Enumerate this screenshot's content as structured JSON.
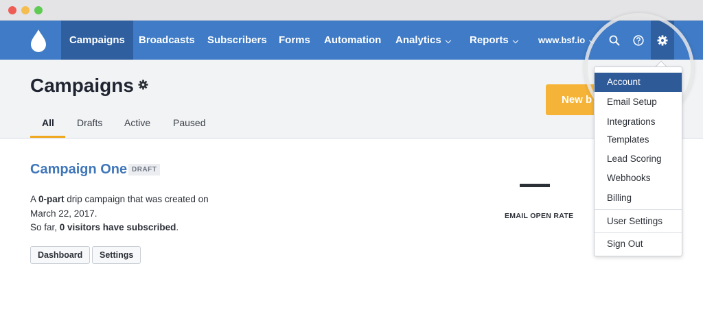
{
  "nav": {
    "items": [
      {
        "label": "Campaigns",
        "active": true,
        "has_dropdown": false
      },
      {
        "label": "Broadcasts",
        "active": false,
        "has_dropdown": false
      },
      {
        "label": "Subscribers",
        "active": false,
        "has_dropdown": false
      },
      {
        "label": "Forms",
        "active": false,
        "has_dropdown": false
      },
      {
        "label": "Automation",
        "active": false,
        "has_dropdown": false
      },
      {
        "label": "Analytics",
        "active": false,
        "has_dropdown": true
      },
      {
        "label": "Reports",
        "active": false,
        "has_dropdown": true
      }
    ],
    "site": "www.bsf.io",
    "icons": [
      "drop-logo",
      "search-icon",
      "help-icon",
      "gear-icon"
    ]
  },
  "header": {
    "title": "Campaigns",
    "tabs": [
      {
        "label": "All",
        "active": true
      },
      {
        "label": "Drafts",
        "active": false
      },
      {
        "label": "Active",
        "active": false
      },
      {
        "label": "Paused",
        "active": false
      }
    ],
    "new_button": "New b"
  },
  "campaign": {
    "title": "Campaign One",
    "badge": "DRAFT",
    "desc_a": "A ",
    "desc_b": "0-part",
    "desc_c": " drip campaign that was created on March 22, 2017.",
    "desc_d": "So far, ",
    "desc_e": "0 visitors have subscribed",
    "desc_f": ".",
    "dashboard_button": "Dashboard",
    "settings_button": "Settings"
  },
  "stats": {
    "open_rate_value": "—",
    "open_rate_label": "EMAIL OPEN RATE"
  },
  "dropdown": {
    "items": [
      {
        "label": "Account",
        "active": true
      },
      {
        "label": "Email Setup",
        "active": false
      },
      {
        "label": "Integrations",
        "active": false
      },
      {
        "label": "Templates",
        "active": false
      },
      {
        "label": "Lead Scoring",
        "active": false
      },
      {
        "label": "Webhooks",
        "active": false
      },
      {
        "label": "Billing",
        "active": false
      },
      {
        "label": "User Settings",
        "active": false
      },
      {
        "label": "Sign Out",
        "active": false
      }
    ]
  },
  "colors": {
    "nav": "#3f7bc6",
    "nav_active": "#2f5f9f",
    "accent": "#f0a81e",
    "link": "#3f76ba"
  }
}
